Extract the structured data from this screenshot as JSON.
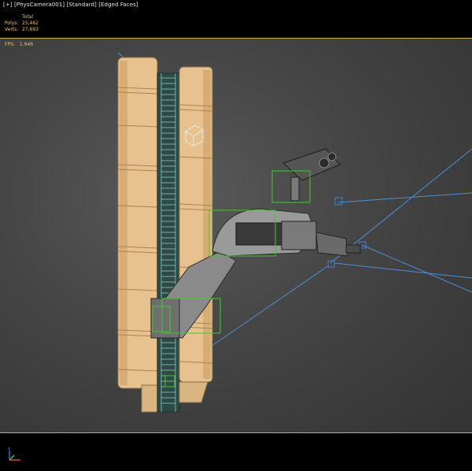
{
  "viewport": {
    "label_plus": "[+]",
    "label_camera": "[PhysCamera001]",
    "label_shading": "[Standard]",
    "label_edges": "[Edged Faces]"
  },
  "stats": {
    "header": "Total",
    "polys_label": "Polys:",
    "polys_value": "25,462",
    "verts_label": "Verts:",
    "verts_value": "27,693"
  },
  "fps": {
    "label": "FPS:",
    "value": "1.946"
  },
  "axis": {
    "x": "x",
    "y": "y",
    "z": "z"
  },
  "colors": {
    "panel": "#e7c28e",
    "ladder": "#2f4a45",
    "mechanism": "#7c7c7c",
    "selection": "#3ccc2a",
    "camera_line": "#4b8fd6",
    "border": "#c9b34a"
  }
}
